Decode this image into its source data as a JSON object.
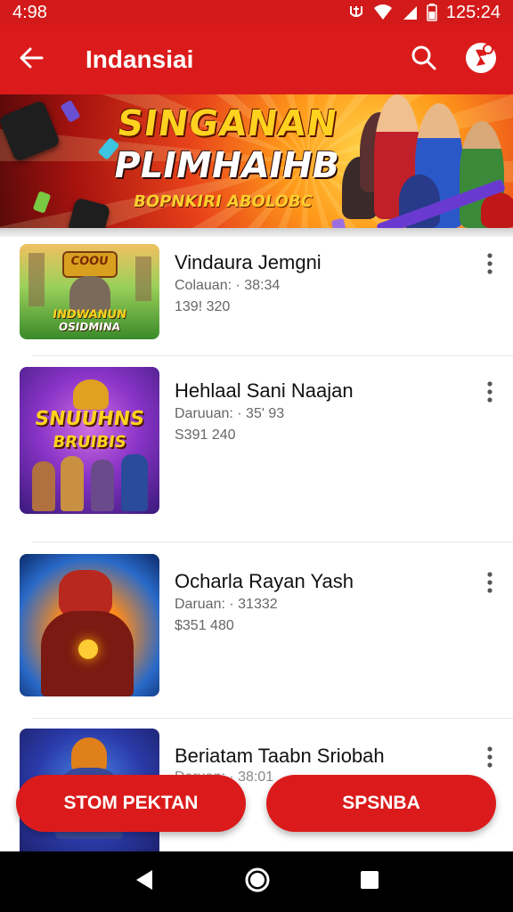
{
  "status_bar": {
    "time_left": "4:98",
    "time_right": "125:24",
    "icons": [
      "signal-icon",
      "wifi-icon",
      "cellular-icon",
      "battery-icon"
    ]
  },
  "app_bar": {
    "title": "Indansiai",
    "back_icon": "back-arrow-icon",
    "search_icon": "search-icon",
    "profile_icon": "profile-badge-icon"
  },
  "banner": {
    "line1": "SINGANAN",
    "line2": "PLIMHAIHB",
    "line3": "BOPNKIRI ABOLOBC"
  },
  "games": [
    {
      "name": "Vindaura Jemgni",
      "meta": "Colauan: · 38:34",
      "sub": "139! 320",
      "thumb_title": "INDWANUN",
      "thumb_sub": "OSIDMINA",
      "thumb_top": "COOU"
    },
    {
      "name": "Hehlaal Sani Naajan",
      "meta": "Daruuan: · 35' 93",
      "sub": "S391 240",
      "thumb_title": "SNUUHNS",
      "thumb_sub": "BRUIBIS"
    },
    {
      "name": "Ocharla Rayan Yash",
      "meta": "Daruan: · 31332",
      "sub": "$351 480"
    },
    {
      "name": "Beriatam Taabn Sriobah",
      "meta": "Daruan: · 38:01",
      "sub": ""
    }
  ],
  "actions": {
    "left_label": "STOM PEKTAN",
    "right_label": "SPSNBA"
  },
  "colors": {
    "primary": "#db1b1b",
    "status": "#d31a1a",
    "navbar": "#000000"
  }
}
